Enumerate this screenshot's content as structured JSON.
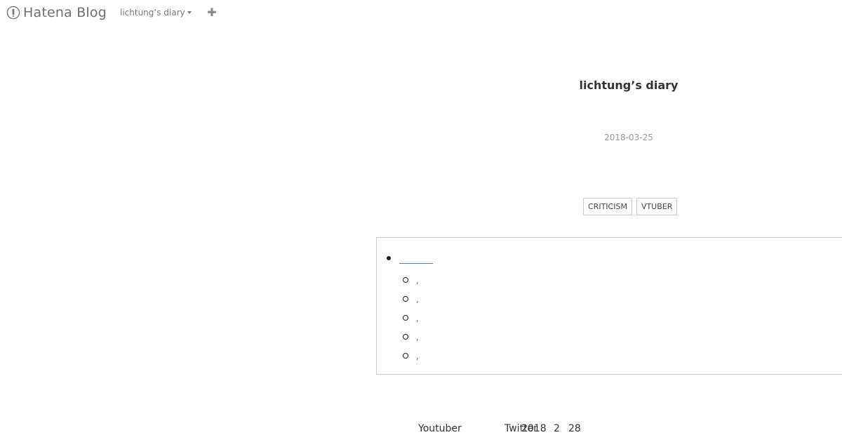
{
  "navbar": {
    "brand": "Hatena Blog",
    "blog_name": "lichtung’s diary",
    "add_symbol": "✚"
  },
  "entry": {
    "blog_title": "lichtung’s diary",
    "date": "2018-03-25",
    "tags": [
      "CRITICISM",
      "VTUBER"
    ]
  },
  "toc": {
    "sub_items": [
      ",",
      ",",
      ",",
      ",",
      ","
    ]
  },
  "bottom": {
    "word_left": "Youtuber",
    "word_mid": "Twitter",
    "year": "2018",
    "month": "2",
    "day": "28"
  },
  "colors": {
    "link": "#4a7fc2",
    "border": "#cccccc",
    "muted": "#999999"
  }
}
